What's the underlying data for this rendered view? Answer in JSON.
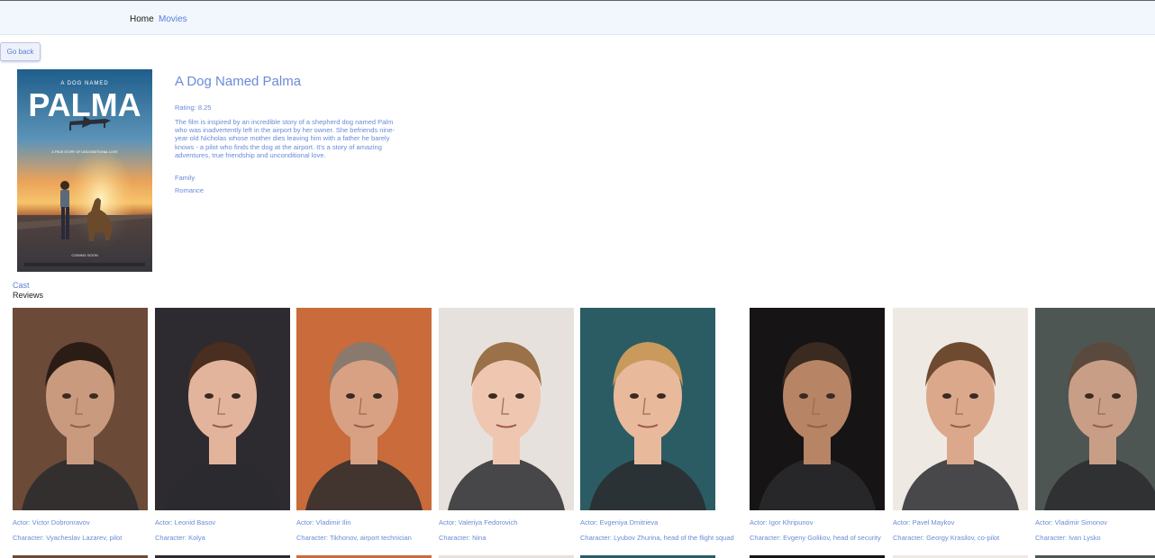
{
  "nav": {
    "home": "Home",
    "movies": "Movies"
  },
  "back_button": "Go back",
  "poster": {
    "kicker": "A DOG NAMED",
    "title": "PALMA",
    "tagline": "A TRUE STORY OF UNCONDITIONAL LOVE",
    "footer": "COMING SOON"
  },
  "movie": {
    "title": "A Dog Named Palma",
    "rating": "Rating: 8.25",
    "overview": "The film is inspired by an incredible story of a shepherd dog named Palm who was inadvertently left in the airport by her owner. She befriends nine-year old Nicholas whose mother dies leaving him with a father he barely knows - a pilot who finds the dog at the airport. It's a story of amazing adventures, true friendship and unconditional love.",
    "genres": [
      "Family",
      "Romance"
    ]
  },
  "sections": {
    "cast": "Cast",
    "reviews": "Reviews"
  },
  "cast": [
    {
      "actor": "Actor: Victor Dobronravov",
      "character": "Character: Vyacheslav Lazarev, pilot",
      "bg": "#6b4a38",
      "skin": "#c99a7e",
      "hair": "#2b1d15"
    },
    {
      "actor": "Actor: Leonid Basov",
      "character": "Character: Kolya",
      "bg": "#2e2b30",
      "skin": "#e3b49c",
      "hair": "#4a2e1f"
    },
    {
      "actor": "Actor: Vladimir Ilin",
      "character": "Character: Tikhonov, airport technician",
      "bg": "#c96b3a",
      "skin": "#d8a184",
      "hair": "#8a7a6e"
    },
    {
      "actor": "Actor: Valeriya Fedorovich",
      "character": "Character: Nina",
      "bg": "#e6e1dc",
      "skin": "#efc6b0",
      "hair": "#9a7148"
    },
    {
      "actor": "Actor: Evgeniya Dmitrieva",
      "character": "Character: Lyubov Zhurina, head of the flight squad",
      "bg": "#2c5c63",
      "skin": "#e9b99c",
      "hair": "#c99a5c"
    },
    {
      "actor": "Actor: Igor Khripunov",
      "character": "Character: Evgeny Golikov, head of security",
      "bg": "#161414",
      "skin": "#b78466",
      "hair": "#3a2a20"
    },
    {
      "actor": "Actor: Pavel Maykov",
      "character": "Character: Georgy Krasilov, co-pilot",
      "bg": "#efe9e4",
      "skin": "#dba88c",
      "hair": "#6e4a30"
    },
    {
      "actor": "Actor: Vladimir Simonov",
      "character": "Character: Ivan Lysko",
      "bg": "#4e5654",
      "skin": "#c99e86",
      "hair": "#5a4a3e"
    }
  ]
}
